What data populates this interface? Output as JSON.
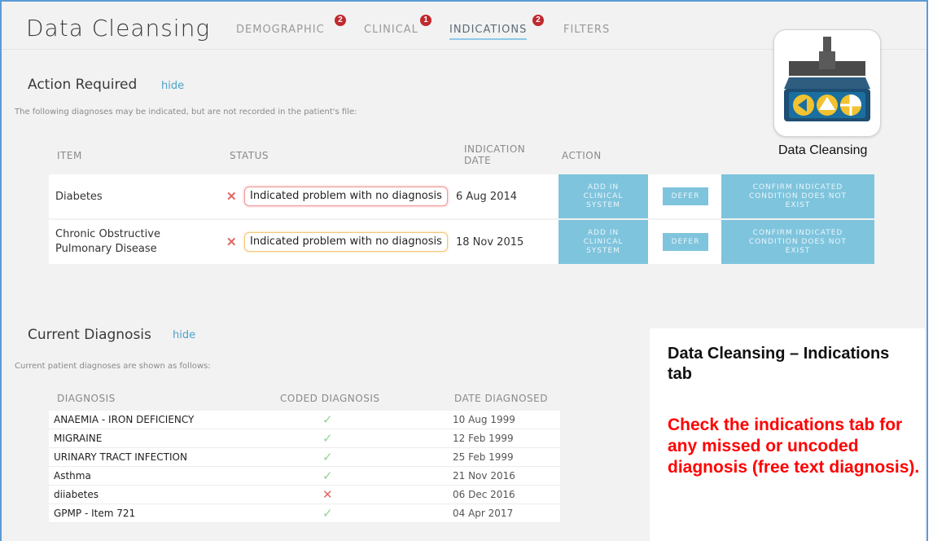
{
  "app": {
    "title": "Data Cleansing"
  },
  "tabs": [
    {
      "label": "DEMOGRAPHIC",
      "badge": "2"
    },
    {
      "label": "CLINICAL",
      "badge": "1"
    },
    {
      "label": "INDICATIONS",
      "badge": "2",
      "active": true
    },
    {
      "label": "FILTERS"
    }
  ],
  "action_required": {
    "title": "Action Required",
    "hide_label": "hide",
    "description": "The following diagnoses may be indicated, but are not recorded in the patient's file:",
    "headers": {
      "item": "ITEM",
      "status": "STATUS",
      "indication_date_1": "INDICATION",
      "indication_date_2": "DATE",
      "action": "ACTION"
    },
    "rows": [
      {
        "item": "Diabetes",
        "status": "Indicated problem with no diagnosis",
        "status_color": "#ef9a9a",
        "date": "6 Aug 2014",
        "add_btn": "ADD IN CLINICAL SYSTEM",
        "defer_btn": "DEFER",
        "confirm_btn": "CONFIRM INDICATED CONDITION DOES NOT EXIST"
      },
      {
        "item": "Chronic Obstructive Pulmonary Disease",
        "status": "Indicated problem with no diagnosis",
        "status_color": "#f6c779",
        "date": "18 Nov 2015",
        "add_btn": "ADD IN CLINICAL SYSTEM",
        "defer_btn": "DEFER",
        "confirm_btn": "CONFIRM INDICATED CONDITION DOES NOT EXIST"
      }
    ]
  },
  "current_diagnosis": {
    "title": "Current Diagnosis",
    "hide_label": "hide",
    "description": "Current patient diagnoses are shown as follows:",
    "headers": {
      "diagnosis": "DIAGNOSIS",
      "coded": "CODED DIAGNOSIS",
      "date": "DATE DIAGNOSED"
    },
    "rows": [
      {
        "name": "ANAEMIA - IRON DEFICIENCY",
        "coded": true,
        "date": "10 Aug 1999"
      },
      {
        "name": "MIGRAINE",
        "coded": true,
        "date": "12 Feb 1999"
      },
      {
        "name": "URINARY TRACT INFECTION",
        "coded": true,
        "date": "25 Feb 1999"
      },
      {
        "name": "Asthma",
        "coded": true,
        "date": "21 Nov 2016"
      },
      {
        "name": "diiabetes",
        "coded": false,
        "date": "06 Dec 2016"
      },
      {
        "name": "GPMP - Item 721",
        "coded": true,
        "date": "04 Apr 2017"
      }
    ]
  },
  "logo": {
    "caption": "Data Cleansing",
    "icon": "data-cleansing-broom-icon"
  },
  "callout": {
    "title": "Data Cleansing – Indications tab",
    "body": "Check the indications tab for any missed or uncoded diagnosis (free text diagnosis)."
  },
  "colors": {
    "accent": "#7fc4dd",
    "alert": "#c0292d",
    "callout_text": "#ff0000",
    "check": "#8fd48f",
    "cross": "#e06666"
  }
}
